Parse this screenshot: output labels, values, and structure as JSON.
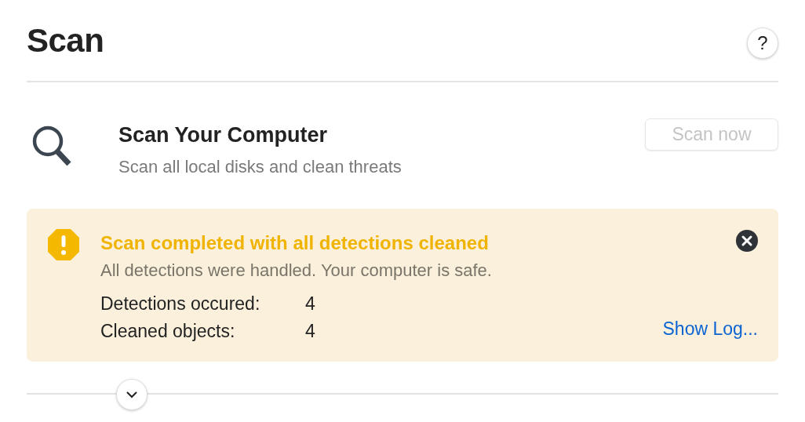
{
  "header": {
    "title": "Scan",
    "help_label": "?"
  },
  "scan_task": {
    "title": "Scan Your Computer",
    "subtitle": "Scan all local disks and clean threats",
    "button": {
      "label": "Scan now",
      "disabled": true
    }
  },
  "alert": {
    "title": "Scan completed with all detections cleaned",
    "message": "All detections were handled. Your computer is safe.",
    "stats": [
      {
        "label": "Detections occured:",
        "value": "4"
      },
      {
        "label": "Cleaned objects:",
        "value": "4"
      }
    ],
    "link": "Show Log..."
  },
  "expander": {
    "expanded": false
  }
}
